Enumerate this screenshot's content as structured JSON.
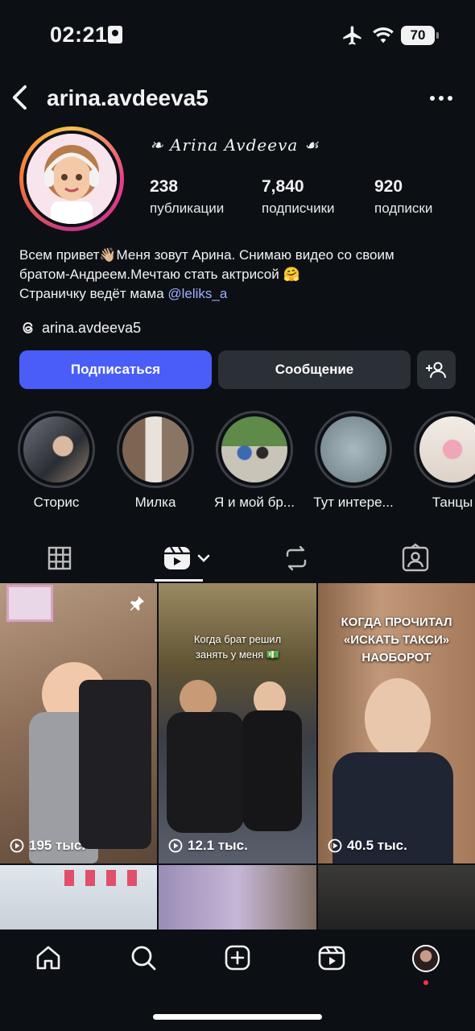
{
  "status_bar": {
    "time": "02:21",
    "battery": "70"
  },
  "header": {
    "username": "arina.avdeeva5"
  },
  "profile": {
    "display_name": "❧ Arina Avdeeva ☙",
    "stats": [
      {
        "value": "238",
        "label": "публикации"
      },
      {
        "value": "7,840",
        "label": "подписчики"
      },
      {
        "value": "920",
        "label": "подписки"
      }
    ],
    "bio_line1": "Всем привет👋🏼Меня зовут Арина. Снимаю видео со своим",
    "bio_line2": "братом-Андреем.Мечтаю стать актрисой 🤗",
    "bio_line3_prefix": "Страничку ведёт мама ",
    "bio_mention": "@leliks_a",
    "threads_handle": "arina.avdeeva5"
  },
  "actions": {
    "follow": "Подписаться",
    "message": "Сообщение"
  },
  "highlights": [
    {
      "label": "Сторис"
    },
    {
      "label": "Милка"
    },
    {
      "label": "Я и мой бр..."
    },
    {
      "label": "Тут интере..."
    },
    {
      "label": "Танцы"
    }
  ],
  "tabs": [
    "grid",
    "reels",
    "reposts",
    "tagged"
  ],
  "grid": [
    {
      "views": "195 тыс.",
      "overlay": ""
    },
    {
      "views": "12.1 тыс.",
      "overlay": "Когда брат решил занять у меня 💵"
    },
    {
      "views": "40.5 тыс.",
      "overlay": "КОГДА ПРОЧИТАЛ «ИСКАТЬ ТАКСИ» НАОБОРОТ"
    }
  ],
  "nav": [
    "home",
    "search",
    "create",
    "reels",
    "profile"
  ],
  "colors": {
    "accent": "#4a5df9",
    "mention": "#9fb0ff",
    "background": "#0c1015",
    "secondary_button": "#2b2f36"
  }
}
